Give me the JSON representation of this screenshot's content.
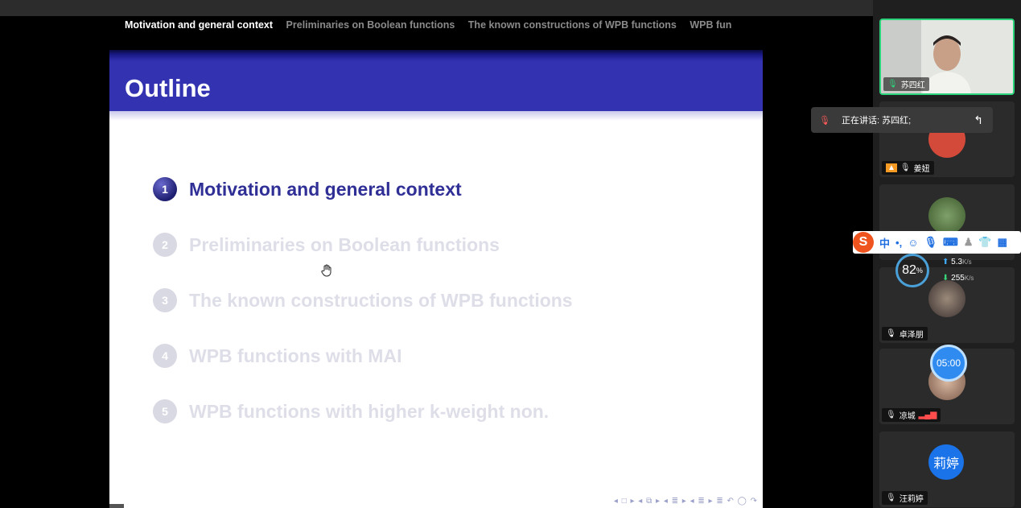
{
  "presentation": {
    "nav_sections": [
      "Motivation and general context",
      "Preliminaries on Boolean functions",
      "The known constructions of WPB functions",
      "WPB fun"
    ],
    "slide_title": "Outline",
    "outline": [
      {
        "num": "1",
        "title": "Motivation and general context",
        "state": "active"
      },
      {
        "num": "2",
        "title": "Preliminaries on Boolean functions",
        "state": "dimmed"
      },
      {
        "num": "3",
        "title": "The known constructions of WPB functions",
        "state": "dimmed"
      },
      {
        "num": "4",
        "title": "WPB functions with MAI",
        "state": "dimmed"
      },
      {
        "num": "5",
        "title": "WPB functions with higher k-weight non.",
        "state": "dimmed"
      }
    ],
    "beamer_nav_symbols": "◂ □ ▸ ◂ ⧉ ▸ ◂ ≣ ▸ ◂ ≣ ▸   ≣   ↶ ◯ ↷"
  },
  "participants": [
    {
      "name": "苏四红",
      "mic": "on"
    },
    {
      "name": "姜妞",
      "mic": "muted"
    },
    {
      "name": "",
      "mic": "muted"
    },
    {
      "name": "卓泽朋",
      "mic": "on"
    },
    {
      "name": "凉城",
      "mic": "muted",
      "signal": "strong"
    },
    {
      "name": "汪莉婷",
      "mic": "muted",
      "avatar_text": "莉婷"
    }
  ],
  "speaking_toast": {
    "label": "正在讲话: 苏四红;"
  },
  "ime_toolbar": {
    "logo": "S",
    "mode": "中",
    "punct": "•,"
  },
  "network_widget": {
    "percent": "82",
    "percent_unit": "%",
    "upload": "5.3",
    "download": "255",
    "unit": "K/s"
  },
  "timer": {
    "value": "05:00"
  },
  "colors": {
    "beamer_blue": "#3333b2",
    "speaker_border": "#2bd37a",
    "timer_blue": "#2f8bf0"
  }
}
